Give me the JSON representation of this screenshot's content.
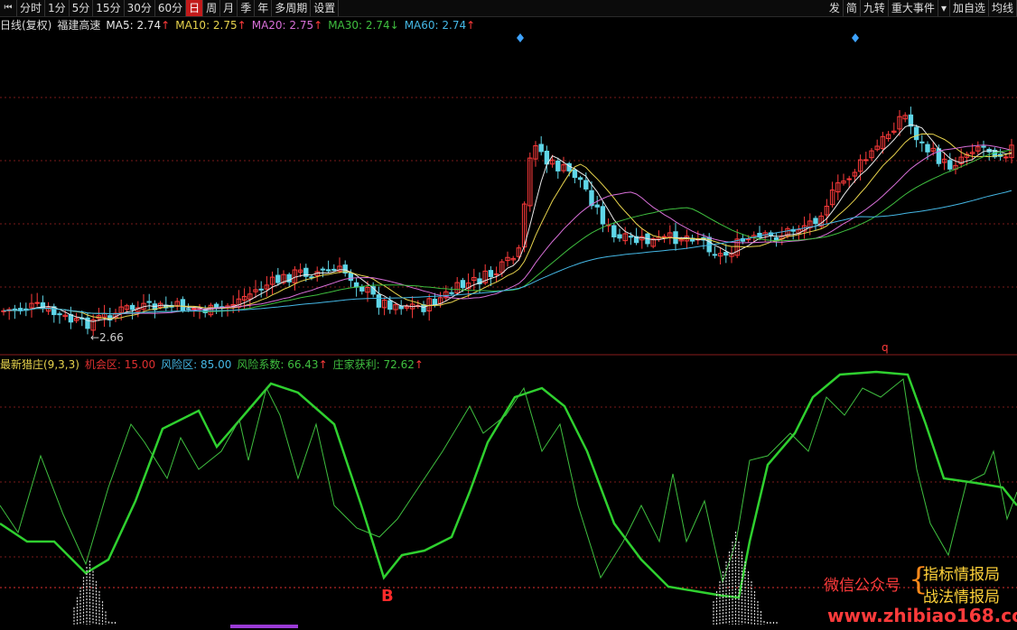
{
  "toolbar": {
    "left": [
      "分时",
      "1分",
      "5分",
      "15分",
      "30分",
      "60分",
      "日",
      "周",
      "月",
      "季",
      "年",
      "多周期",
      "设置"
    ],
    "active": "日",
    "right": [
      "发",
      "简",
      "九转",
      "重大事件",
      "加自选",
      "均线"
    ]
  },
  "main_info": {
    "period": "日线(复权)",
    "stock": "福建高速",
    "ma": [
      {
        "label": "MA5: 2.74",
        "arrow": "↑",
        "color": "#e8e8e8"
      },
      {
        "label": "MA10: 2.75",
        "arrow": "↑",
        "color": "#e8d44d"
      },
      {
        "label": "MA20: 2.75",
        "arrow": "↑",
        "color": "#d86fd8"
      },
      {
        "label": "MA30: 2.74",
        "arrow": "↓",
        "color": "#3fbf3f"
      },
      {
        "label": "MA60: 2.74",
        "arrow": "↑",
        "color": "#45b8e6"
      }
    ]
  },
  "indicator_info": {
    "name": "最新猎庄(9,3,3)",
    "items": [
      {
        "label": "机会区: 15.00",
        "color": "#e03030"
      },
      {
        "label": "风险区: 85.00",
        "color": "#45b8e6"
      },
      {
        "label": "风险系数: 66.43",
        "color": "#3fbf3f",
        "arrow": "↑"
      },
      {
        "label": "庄家获利: 72.62",
        "color": "#3fbf3f",
        "arrow": "↑"
      }
    ]
  },
  "annotations": {
    "low_price": "2.66",
    "signal_b": "B",
    "signal_q": "q"
  },
  "watermark": {
    "line1": "微信公众号",
    "right1": "指标情报局",
    "right2": "战法情报局",
    "url": "www.zhibiao168.com"
  },
  "colors": {
    "up": "#ff3b3b",
    "down": "#5fd6e8",
    "grid": "#7a1a1a",
    "k_line": "#3fbf3f",
    "d_line": "#2fd02f",
    "ma5": "#e8e8e8",
    "ma10": "#e8d44d",
    "ma20": "#d86fd8",
    "ma30": "#3fbf3f",
    "ma60": "#45b8e6"
  },
  "chart_data": [
    {
      "type": "candlestick",
      "title": "福建高速",
      "series": [
        {
          "name": "MA5",
          "values": [
            2.74
          ]
        },
        {
          "name": "MA10",
          "values": [
            2.75
          ]
        },
        {
          "name": "MA20",
          "values": [
            2.75
          ]
        },
        {
          "name": "MA30",
          "values": [
            2.74
          ]
        },
        {
          "name": "MA60",
          "values": [
            2.74
          ]
        }
      ],
      "lowest_label": 2.66
    },
    {
      "type": "line",
      "title": "最新猎庄(9,3,3)",
      "ylim": [
        0,
        100
      ],
      "series": [
        {
          "name": "机会区",
          "values": [
            15.0
          ]
        },
        {
          "name": "风险区",
          "values": [
            85.0
          ]
        },
        {
          "name": "风险系数",
          "values": [
            66.43
          ]
        },
        {
          "name": "庄家获利",
          "values": [
            72.62
          ]
        }
      ]
    }
  ]
}
